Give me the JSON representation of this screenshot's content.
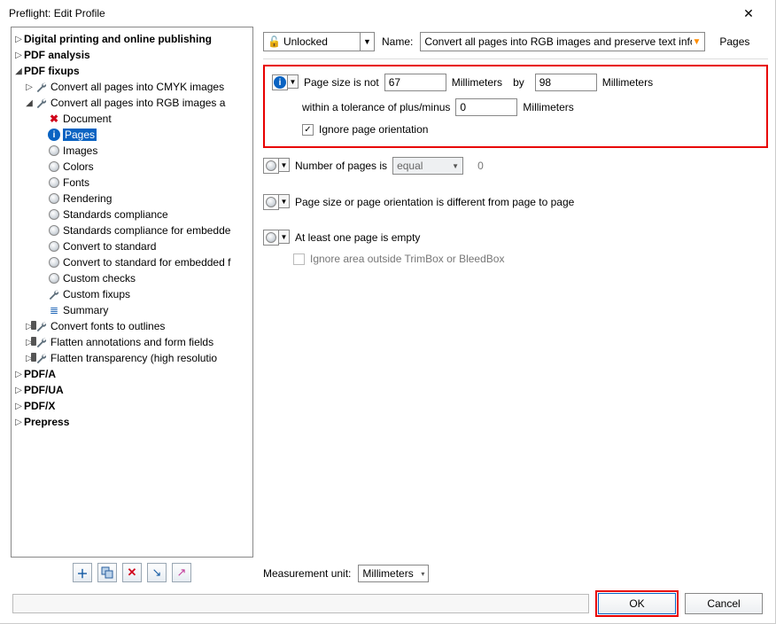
{
  "window": {
    "title": "Preflight: Edit Profile"
  },
  "topbar": {
    "lock_state": "Unlocked",
    "name_label": "Name:",
    "profile_name": "Convert all pages into RGB images and preserve text informat",
    "category_link": "Pages"
  },
  "tree": {
    "digital": "Digital printing and online publishing",
    "pdf_analysis": "PDF analysis",
    "pdf_fixups": "PDF fixups",
    "cmyk": "Convert all pages into CMYK images",
    "rgb": "Convert all pages into RGB images a",
    "document": "Document",
    "pages": "Pages",
    "images": "Images",
    "colors": "Colors",
    "fonts": "Fonts",
    "rendering": "Rendering",
    "std": "Standards compliance",
    "std_emb": "Standards compliance for embedde",
    "conv_std": "Convert to standard",
    "conv_std_emb": "Convert to standard for embedded f",
    "cchecks": "Custom checks",
    "cfixups": "Custom fixups",
    "summary": "Summary",
    "convert_fonts": "Convert fonts to outlines",
    "flatten_ann": "Flatten annotations and form fields",
    "flatten_tr": "Flatten transparency (high resolutio",
    "pdfa": "PDF/A",
    "pdfua": "PDF/UA",
    "pdfx": "PDF/X",
    "prepress": "Prepress"
  },
  "settings": {
    "ps_label": "Page size is not",
    "ps_w": "67",
    "ps_unit_w": "Millimeters",
    "ps_by": "by",
    "ps_h": "98",
    "ps_unit_h": "Millimeters",
    "tol_label": "within a tolerance of plus/minus",
    "tol_val": "0",
    "tol_unit": "Millimeters",
    "ignore_orient": "Ignore page orientation",
    "np_label": "Number of pages is",
    "np_op": "equal",
    "np_val": "0",
    "diff_label": "Page size or page orientation is different from page to page",
    "empty_label": "At least one page is empty",
    "ignore_area": "Ignore area outside TrimBox or BleedBox",
    "mu_label": "Measurement unit:",
    "mu_val": "Millimeters"
  },
  "footer": {
    "ok": "OK",
    "cancel": "Cancel"
  }
}
